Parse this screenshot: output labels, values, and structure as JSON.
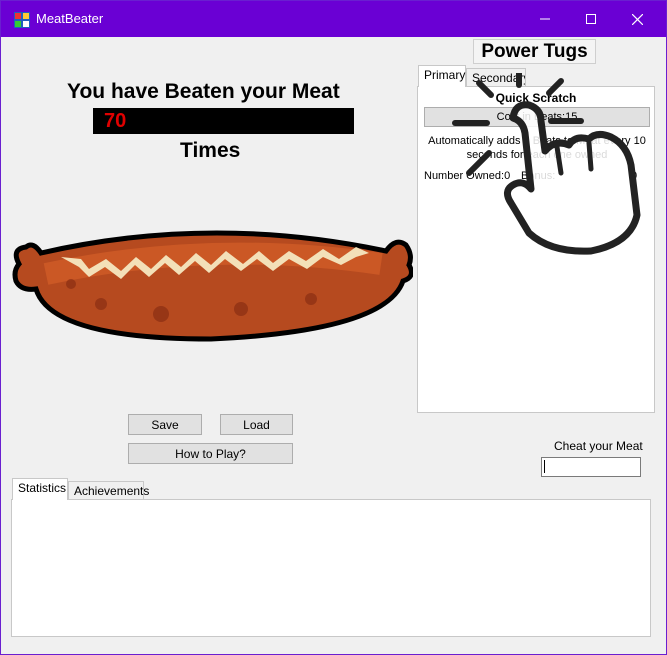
{
  "window": {
    "title": "MeatBeater",
    "accent_color": "#6a00d4"
  },
  "main": {
    "headline": "You have Beaten your Meat",
    "counter": "70",
    "counter_color": "#e00000",
    "times_label": "Times",
    "buttons": {
      "save": "Save",
      "load": "Load",
      "how_to_play": "How to Play?"
    }
  },
  "power_tugs": {
    "title": "Power Tugs",
    "tabs": [
      "Primary",
      "Secondary"
    ],
    "upgrade": {
      "name": "Quick Scratch",
      "cost": "Cost in Beats:15",
      "description": "Automatically adds 1 Beats to Meat every 10 seconds for each one owned",
      "owned": "Number Owned:0",
      "bonus_label": "Bonus:",
      "bonus_value": "0"
    }
  },
  "cheat": {
    "label": "Cheat your Meat",
    "value": ""
  },
  "bottom_tabs": [
    "Statistics",
    "Achievements"
  ]
}
